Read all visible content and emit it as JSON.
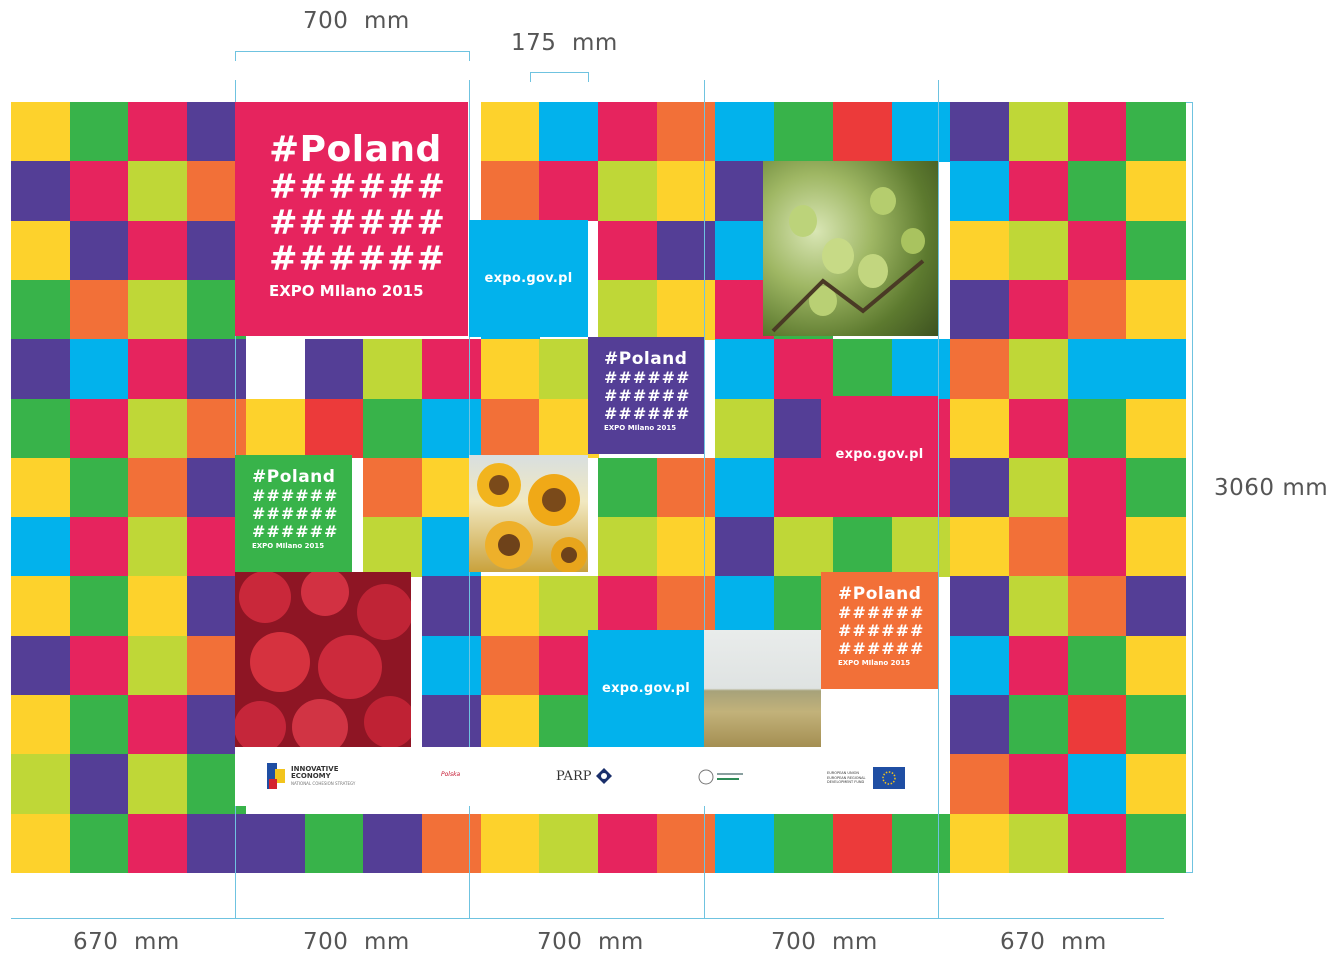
{
  "dimensions": {
    "top_width_label": "700  mm",
    "top_module_label": "175  mm",
    "right_height_label": "3060 mm",
    "bottom_labels": [
      "670  mm",
      "700  mm",
      "700  mm",
      "700  mm",
      "670  mm"
    ]
  },
  "branding": {
    "hashtag": "#Poland",
    "hash_row": "######",
    "event": "EXPO MIlano 2015",
    "url": "expo.gov.pl"
  },
  "logos": {
    "innovative_economy": "INNOVATIVE ECONOMY",
    "innovative_sub": "NATIONAL COHESION STRATEGY",
    "polska": "Polska",
    "parp": "PARP",
    "eu_text": "EUROPEAN UNION EUROPEAN REGIONAL DEVELOPMENT FUND"
  },
  "palette": {
    "yellow": "#fdd22c",
    "green": "#38b34a",
    "pink": "#e6245e",
    "purple": "#543e96",
    "orange": "#f27038",
    "lime": "#bfd737",
    "cyan": "#02b2ec",
    "red": "#ec3a3a"
  },
  "photos": [
    "apples-photo",
    "sunflowers-photo",
    "raspberries-photo",
    "wheat-field-photo"
  ]
}
